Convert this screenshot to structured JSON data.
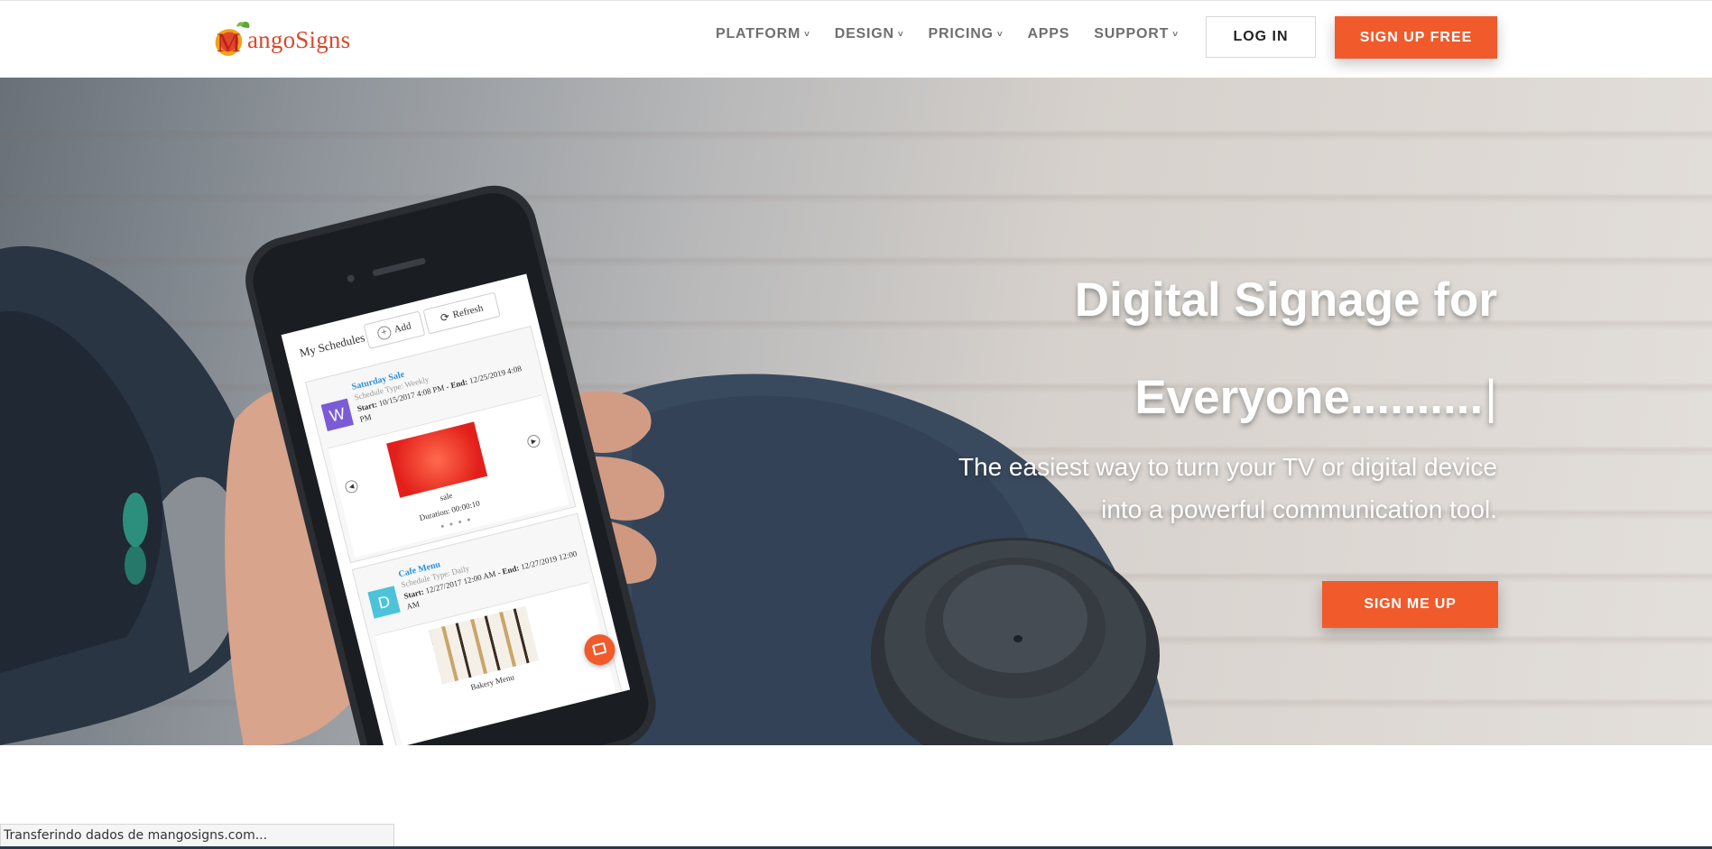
{
  "brand": {
    "logo_text": "angoSigns",
    "logo_initial": "M"
  },
  "nav": {
    "items": [
      {
        "label": "PLATFORM",
        "has_dropdown": true
      },
      {
        "label": "DESIGN",
        "has_dropdown": true
      },
      {
        "label": "PRICING",
        "has_dropdown": true
      },
      {
        "label": "APPS",
        "has_dropdown": false
      },
      {
        "label": "SUPPORT",
        "has_dropdown": true
      }
    ],
    "caret": "˅",
    "login_label": "LOG IN",
    "signup_label": "SIGN UP FREE"
  },
  "hero": {
    "title_line1": "Digital Signage for",
    "title_line2": "Everyone..........",
    "cursor": "|",
    "subtitle": "The easiest way to turn your TV or digital device into a powerful communication tool.",
    "cta_label": "SIGN ME UP"
  },
  "phone": {
    "screen_title": "My Schedules",
    "add_label": "Add",
    "refresh_label": "Refresh",
    "schedules": [
      {
        "initial": "W",
        "name": "Saturday Sale",
        "type": "Schedule Type: Weekly",
        "start_label": "Start:",
        "start": "10/15/2017 4:08 PM",
        "end_label": "End:",
        "end": "12/25/2019 4:08 PM",
        "media_name": "sale",
        "duration": "Duration: 00:00:10",
        "badge_color": "#7b5bd6"
      },
      {
        "initial": "D",
        "name": "Cafe Menu",
        "type": "Schedule Type: Daily",
        "start_label": "Start:",
        "start": "12/27/2017 12:00 AM",
        "end_label": "End:",
        "end": "12/27/2019 12:00 AM",
        "media_name": "Bakery Menu",
        "badge_color": "#4cc3d9"
      }
    ]
  },
  "colors": {
    "accent": "#f15a2b",
    "nav_text": "#6f6f6f",
    "schedule_link": "#2a8fd6"
  },
  "status_bar": {
    "text": "Transferindo dados de mangosigns.com..."
  }
}
